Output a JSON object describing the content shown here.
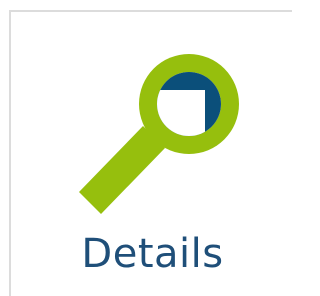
{
  "tile": {
    "label": "Details",
    "icon": "magnifier-details-icon"
  },
  "colors": {
    "accent_green": "#96bf0d",
    "lens_blue": "#0b4f7a",
    "label_blue": "#1f4f79",
    "border_gray": "#dcdcdc"
  }
}
